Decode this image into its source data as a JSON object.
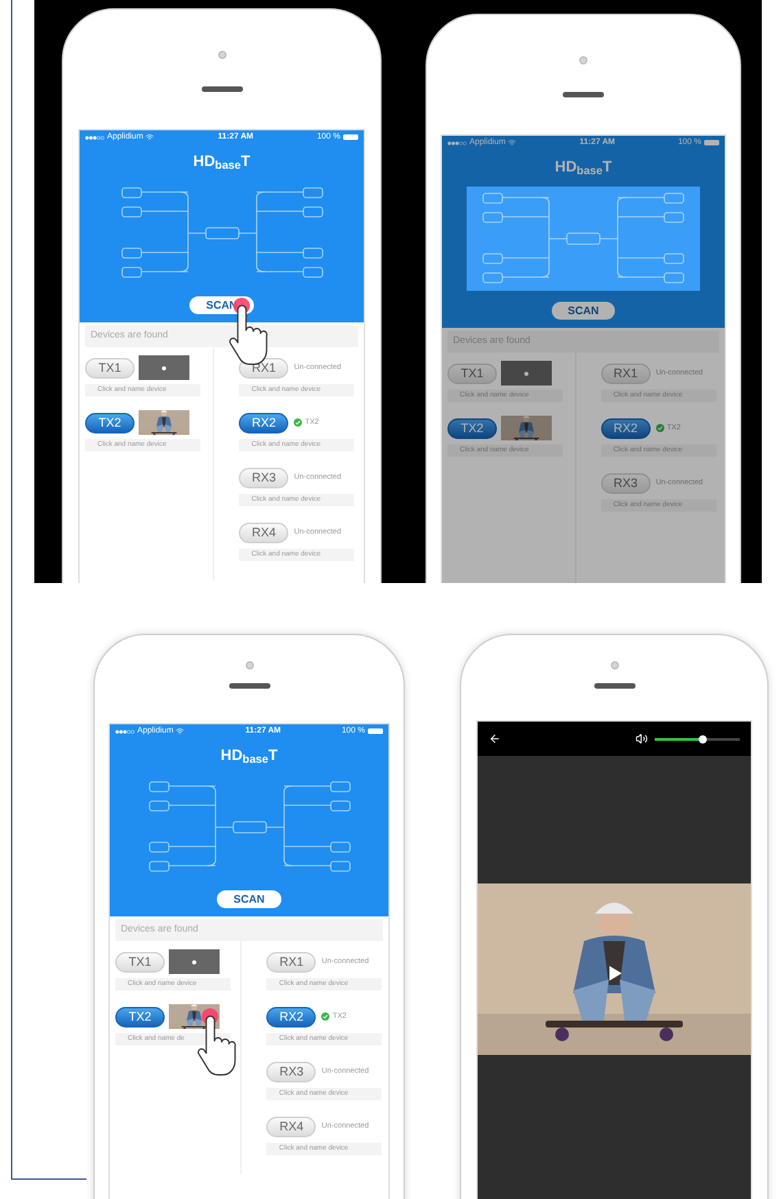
{
  "screens": [
    {
      "kind": "devices",
      "dimmed": false,
      "status_bar": {
        "carrier": "Applidium",
        "time": "11:27 AM",
        "battery": "100 %"
      },
      "title": "HD$_{base}$T",
      "scan": {
        "label": "SCAN",
        "touched": true
      },
      "section_title": "Devices are found",
      "transmitters": [
        {
          "label": "TX1",
          "selected": false,
          "thumbnail": {
            "kind": "video"
          },
          "touched": false,
          "hint": "Click and name device"
        },
        {
          "label": "TX2",
          "selected": true,
          "touched": false,
          "hint": "Click and name device"
        }
      ],
      "receivers": [
        {
          "label": "RX1",
          "selected": false,
          "connected": false,
          "status": "Un-connected",
          "hint": "Click and name device"
        },
        {
          "label": "RX2",
          "selected": true,
          "connected": true,
          "status": "TX2",
          "hint": "Click and name device"
        },
        {
          "label": "RX3",
          "selected": false,
          "connected": false,
          "status": "Un-connected",
          "hint": "Click and name device"
        },
        {
          "label": "RX4",
          "selected": false,
          "connected": false,
          "status": "Un-connected",
          "hint": "Click and name device"
        }
      ]
    },
    {
      "kind": "devices",
      "dimmed": true,
      "status_bar": {
        "carrier": "Applidium",
        "time": "11:27 AM",
        "battery": "100 %"
      },
      "title": "HD$_{base}$T",
      "scan": {
        "label": "SCAN",
        "touched": false
      },
      "section_title": "Devices are found",
      "transmitters": [
        {
          "label": "TX1",
          "selected": false,
          "thumbnail": {
            "kind": "video"
          },
          "touched": false,
          "hint": "Click and name device"
        },
        {
          "label": "TX2",
          "selected": true,
          "touched": false,
          "hint": "Click and name device"
        }
      ],
      "receivers": [
        {
          "label": "RX1",
          "selected": false,
          "connected": false,
          "status": "Un-connected",
          "hint": "Click and name device"
        },
        {
          "label": "RX2",
          "selected": true,
          "connected": true,
          "status": "TX2",
          "hint": "Click and name device"
        },
        {
          "label": "RX3",
          "selected": false,
          "connected": false,
          "status": "Un-connected",
          "hint": "Click and name device"
        }
      ]
    },
    {
      "kind": "devices",
      "dimmed": false,
      "status_bar": {
        "carrier": "Applidium",
        "time": "11:27 AM",
        "battery": "100 %"
      },
      "title": "HD$_{base}$T",
      "scan": {
        "label": "SCAN",
        "touched": false
      },
      "section_title": "Devices are found",
      "transmitters": [
        {
          "label": "TX1",
          "selected": false,
          "thumbnail": {
            "kind": "video"
          },
          "touched": false,
          "hint": "Click and name device"
        },
        {
          "label": "TX2",
          "selected": true,
          "touched": true,
          "hint": "Click and name de"
        }
      ],
      "receivers": [
        {
          "label": "RX1",
          "selected": false,
          "connected": false,
          "status": "Un-connected",
          "hint": "Click and name device"
        },
        {
          "label": "RX2",
          "selected": true,
          "connected": true,
          "status": "TX2",
          "hint": "Click and name device"
        },
        {
          "label": "RX3",
          "selected": false,
          "connected": false,
          "status": "Un-connected",
          "hint": "Click and name device"
        },
        {
          "label": "RX4",
          "selected": false,
          "connected": false,
          "status": "Un-connected",
          "hint": "Click and name device"
        }
      ]
    },
    {
      "kind": "player",
      "volume": {
        "level": 0.57
      }
    }
  ]
}
